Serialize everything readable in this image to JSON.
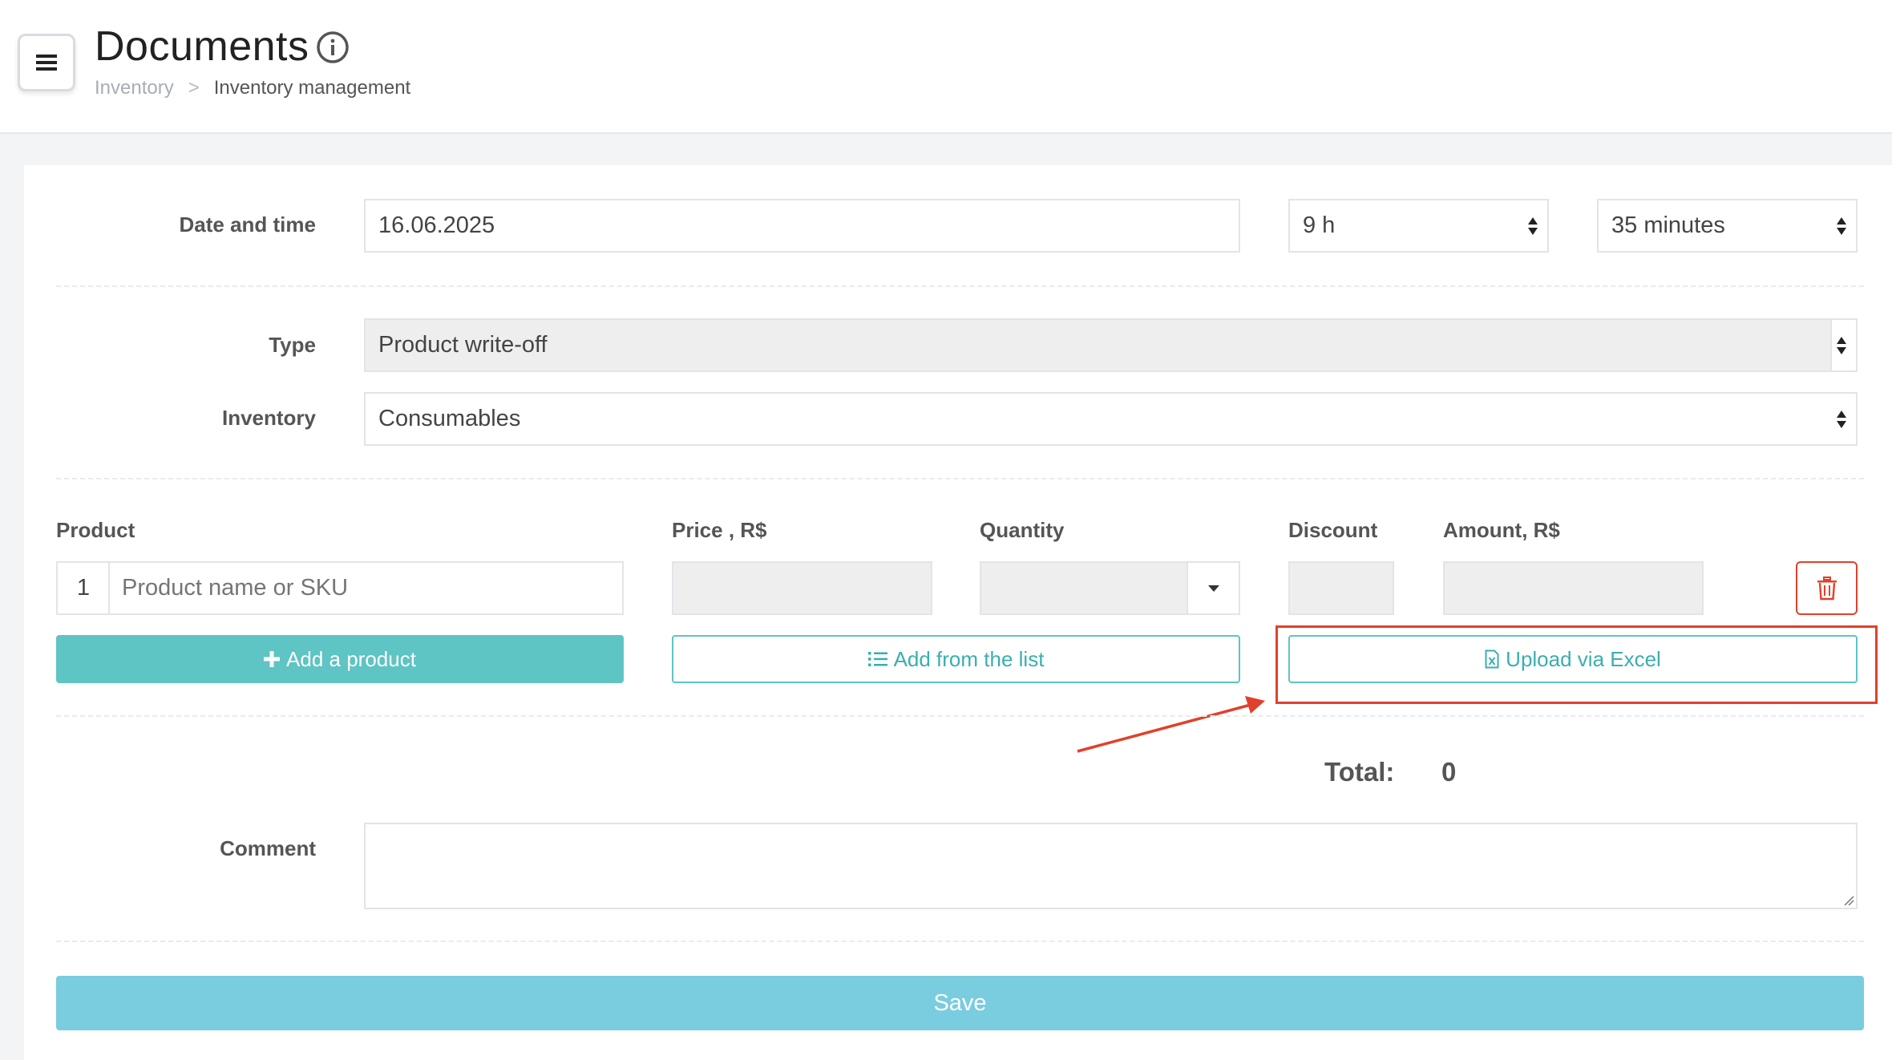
{
  "header": {
    "title": "Documents",
    "breadcrumb": [
      "Inventory",
      "Inventory management"
    ],
    "breadcrumb_separator": ">"
  },
  "form": {
    "date_label": "Date and time",
    "date_value": "16.06.2025",
    "hour_value": "9 h",
    "minute_value": "35 minutes",
    "type_label": "Type",
    "type_value": "Product write-off",
    "inventory_label": "Inventory",
    "inventory_value": "Consumables"
  },
  "products": {
    "headers": {
      "product": "Product",
      "price": "Price , R$",
      "quantity": "Quantity",
      "discount": "Discount",
      "amount": "Amount, R$"
    },
    "row_number": "1",
    "product_placeholder": "Product name or SKU",
    "add_product_label": "Add a product",
    "add_from_list_label": "Add from the list",
    "upload_excel_label": "Upload via Excel"
  },
  "total": {
    "label": "Total:",
    "value": "0"
  },
  "comment": {
    "label": "Comment"
  },
  "save_label": "Save",
  "colors": {
    "accent": "#5ec4c4",
    "save": "#7accdf",
    "delete": "#e0412b",
    "annotation": "#e0412b"
  },
  "icons": [
    "menu-icon",
    "info-icon",
    "chevron-right-icon",
    "select-arrows-icon",
    "caret-down-icon",
    "trash-icon",
    "plus-icon",
    "list-icon",
    "excel-file-icon",
    "resize-handle-icon"
  ]
}
